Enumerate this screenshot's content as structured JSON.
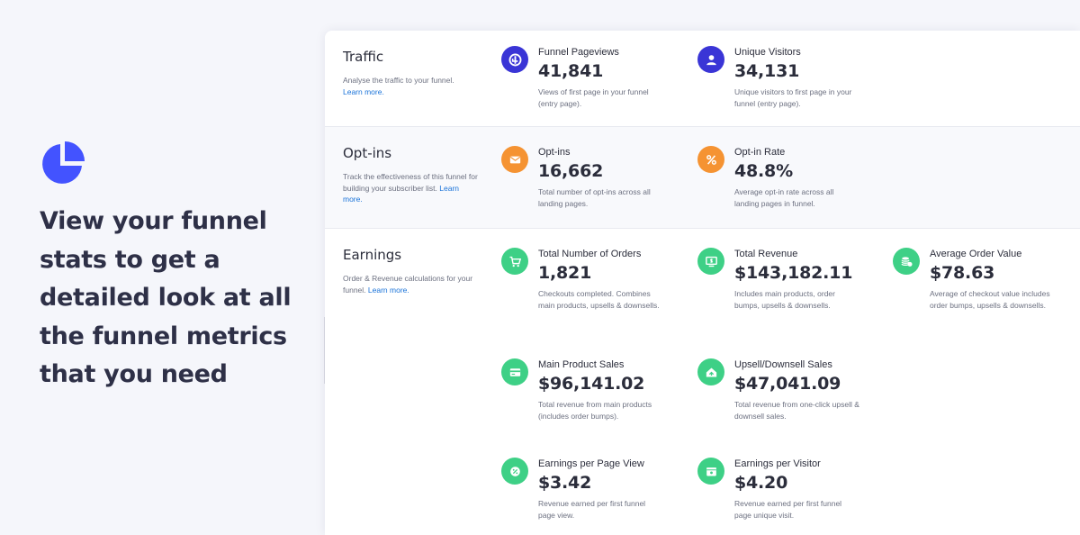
{
  "hero": {
    "icon": "pie-chart-icon",
    "headline": "View your funnel stats to get a detailed look at all the funnel metrics that you need",
    "accent_color": "#4353ff"
  },
  "colors": {
    "traffic": "#3a35d6",
    "optins": "#f59332",
    "earnings": "#3ed086"
  },
  "sections": {
    "traffic": {
      "title": "Traffic",
      "description": "Analyse the traffic to your funnel.",
      "link": "Learn more.",
      "metrics": [
        {
          "icon": "pageview-icon",
          "label": "Funnel Pageviews",
          "value": "41,841",
          "description": "Views of first page in your funnel (entry page)."
        },
        {
          "icon": "user-icon",
          "label": "Unique Visitors",
          "value": "34,131",
          "description": "Unique visitors to first page in your funnel (entry page)."
        }
      ]
    },
    "optins": {
      "title": "Opt-ins",
      "description": "Track the effectiveness of this funnel for building your subscriber list.",
      "link": "Learn more.",
      "metrics": [
        {
          "icon": "envelope-icon",
          "label": "Opt-ins",
          "value": "16,662",
          "description": "Total number of opt-ins across all landing pages."
        },
        {
          "icon": "percent-icon",
          "label": "Opt-in Rate",
          "value": "48.8%",
          "description": "Average opt-in rate across all landing pages in funnel."
        }
      ]
    },
    "earnings": {
      "title": "Earnings",
      "description": "Order & Revenue calculations for your funnel.",
      "link": "Learn more.",
      "metrics": [
        {
          "icon": "cart-icon",
          "label": "Total Number of Orders",
          "value": "1,821",
          "description": "Checkouts completed. Combines main products, upsells & downsells."
        },
        {
          "icon": "revenue-icon",
          "label": "Total Revenue",
          "value": "$143,182.11",
          "description": "Includes main products, order bumps, upsells & downsells."
        },
        {
          "icon": "coins-icon",
          "label": "Average Order Value",
          "value": "$78.63",
          "description": "Average of checkout value includes order bumps, upsells & downsells."
        },
        {
          "icon": "card-icon",
          "label": "Main Product Sales",
          "value": "$96,141.02",
          "description": "Total revenue from main products (includes order bumps)."
        },
        {
          "icon": "upsell-icon",
          "label": "Upsell/Downsell Sales",
          "value": "$47,041.09",
          "description": "Total revenue from one-click upsell & downsell sales."
        },
        {
          "icon": "page-view-dollar-icon",
          "label": "Earnings per Page View",
          "value": "$3.42",
          "description": "Revenue earned per first funnel page view."
        },
        {
          "icon": "wallet-icon",
          "label": "Earnings per Visitor",
          "value": "$4.20",
          "description": "Revenue earned per first funnel page unique visit."
        }
      ]
    }
  }
}
